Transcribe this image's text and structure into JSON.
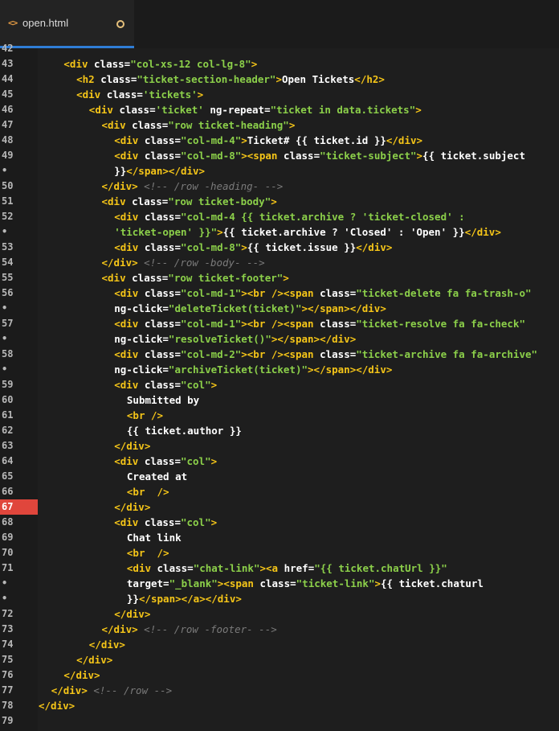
{
  "tab": {
    "icon": "html-code-icon",
    "filename": "open.html",
    "modified_indicator": "unsaved-dot-icon"
  },
  "gutter": {
    "marked_line": "67",
    "colors": {
      "marker": "#e0463c",
      "tag": "#f5c518",
      "string": "#8cd04a",
      "comment": "#7a7a7a"
    }
  },
  "lines": [
    {
      "n": "42",
      "indent": 0,
      "tokens": []
    },
    {
      "n": "43",
      "indent": 4,
      "tokens": [
        [
          "tg",
          "<div "
        ],
        [
          "at",
          "class="
        ],
        [
          "st",
          "\"col-xs-12 col-lg-8\""
        ],
        [
          "tg",
          ">"
        ]
      ]
    },
    {
      "n": "44",
      "indent": 6,
      "tokens": [
        [
          "tg",
          "<h2 "
        ],
        [
          "at",
          "class="
        ],
        [
          "st",
          "\"ticket-section-header\""
        ],
        [
          "tg",
          ">"
        ],
        [
          "tx",
          "Open Tickets"
        ],
        [
          "tg",
          "</h2>"
        ]
      ]
    },
    {
      "n": "45",
      "indent": 6,
      "tokens": [
        [
          "tg",
          "<div "
        ],
        [
          "at",
          "class="
        ],
        [
          "st",
          "'tickets'"
        ],
        [
          "tg",
          ">"
        ]
      ]
    },
    {
      "n": "46",
      "indent": 8,
      "tokens": [
        [
          "tg",
          "<div "
        ],
        [
          "at",
          "class="
        ],
        [
          "st",
          "'ticket'"
        ],
        [
          "at",
          " ng-repeat="
        ],
        [
          "st",
          "\"ticket in data.tickets\""
        ],
        [
          "tg",
          ">"
        ]
      ]
    },
    {
      "n": "47",
      "indent": 10,
      "tokens": [
        [
          "tg",
          "<div "
        ],
        [
          "at",
          "class="
        ],
        [
          "st",
          "\"row ticket-heading\""
        ],
        [
          "tg",
          ">"
        ]
      ]
    },
    {
      "n": "48",
      "indent": 12,
      "tokens": [
        [
          "tg",
          "<div "
        ],
        [
          "at",
          "class="
        ],
        [
          "st",
          "\"col-md-4\""
        ],
        [
          "tg",
          ">"
        ],
        [
          "tx",
          "Ticket# {{ ticket.id }}"
        ],
        [
          "tg",
          "</div>"
        ]
      ]
    },
    {
      "n": "49",
      "indent": 12,
      "tokens": [
        [
          "tg",
          "<div "
        ],
        [
          "at",
          "class="
        ],
        [
          "st",
          "\"col-md-8\""
        ],
        [
          "tg",
          ">"
        ],
        [
          "tg",
          "<span "
        ],
        [
          "at",
          "class="
        ],
        [
          "st",
          "\"ticket-subject\""
        ],
        [
          "tg",
          ">"
        ],
        [
          "tx",
          "{{ ticket.subject"
        ]
      ]
    },
    {
      "n": "•",
      "indent": 12,
      "tokens": [
        [
          "tx",
          "}}"
        ],
        [
          "tg",
          "</span></div>"
        ]
      ]
    },
    {
      "n": "50",
      "indent": 10,
      "tokens": [
        [
          "tg",
          "</div>"
        ],
        [
          "cm",
          " <!-- /row -heading- -->"
        ]
      ]
    },
    {
      "n": "51",
      "indent": 10,
      "tokens": [
        [
          "tg",
          "<div "
        ],
        [
          "at",
          "class="
        ],
        [
          "st",
          "\"row ticket-body\""
        ],
        [
          "tg",
          ">"
        ]
      ]
    },
    {
      "n": "52",
      "indent": 12,
      "tokens": [
        [
          "tg",
          "<div "
        ],
        [
          "at",
          "class="
        ],
        [
          "st",
          "\"col-md-4 {{ ticket.archive ? 'ticket-closed' :"
        ]
      ]
    },
    {
      "n": "•",
      "indent": 12,
      "tokens": [
        [
          "st",
          "'ticket-open' }}\""
        ],
        [
          "tg",
          ">"
        ],
        [
          "tx",
          "{{ ticket.archive ? 'Closed' : 'Open' }}"
        ],
        [
          "tg",
          "</div>"
        ]
      ]
    },
    {
      "n": "53",
      "indent": 12,
      "tokens": [
        [
          "tg",
          "<div "
        ],
        [
          "at",
          "class="
        ],
        [
          "st",
          "\"col-md-8\""
        ],
        [
          "tg",
          ">"
        ],
        [
          "tx",
          "{{ ticket.issue }}"
        ],
        [
          "tg",
          "</div>"
        ]
      ]
    },
    {
      "n": "54",
      "indent": 10,
      "tokens": [
        [
          "tg",
          "</div>"
        ],
        [
          "cm",
          " <!-- /row -body- -->"
        ]
      ]
    },
    {
      "n": "55",
      "indent": 10,
      "tokens": [
        [
          "tg",
          "<div "
        ],
        [
          "at",
          "class="
        ],
        [
          "st",
          "\"row ticket-footer\""
        ],
        [
          "tg",
          ">"
        ]
      ]
    },
    {
      "n": "56",
      "indent": 12,
      "tokens": [
        [
          "tg",
          "<div "
        ],
        [
          "at",
          "class="
        ],
        [
          "st",
          "\"col-md-1\""
        ],
        [
          "tg",
          ">"
        ],
        [
          "tg",
          "<br />"
        ],
        [
          "tg",
          "<span "
        ],
        [
          "at",
          "class="
        ],
        [
          "st",
          "\"ticket-delete fa fa-trash-o\""
        ]
      ]
    },
    {
      "n": "•",
      "indent": 12,
      "tokens": [
        [
          "at",
          "ng-click="
        ],
        [
          "st",
          "\"deleteTicket(ticket)\""
        ],
        [
          "tg",
          "></span></div>"
        ]
      ]
    },
    {
      "n": "57",
      "indent": 12,
      "tokens": [
        [
          "tg",
          "<div "
        ],
        [
          "at",
          "class="
        ],
        [
          "st",
          "\"col-md-1\""
        ],
        [
          "tg",
          ">"
        ],
        [
          "tg",
          "<br />"
        ],
        [
          "tg",
          "<span "
        ],
        [
          "at",
          "class="
        ],
        [
          "st",
          "\"ticket-resolve fa fa-check\""
        ]
      ]
    },
    {
      "n": "•",
      "indent": 12,
      "tokens": [
        [
          "at",
          "ng-click="
        ],
        [
          "st",
          "\"resolveTicket()\""
        ],
        [
          "tg",
          "></span></div>"
        ]
      ]
    },
    {
      "n": "58",
      "indent": 12,
      "tokens": [
        [
          "tg",
          "<div "
        ],
        [
          "at",
          "class="
        ],
        [
          "st",
          "\"col-md-2\""
        ],
        [
          "tg",
          ">"
        ],
        [
          "tg",
          "<br />"
        ],
        [
          "tg",
          "<span "
        ],
        [
          "at",
          "class="
        ],
        [
          "st",
          "\"ticket-archive fa fa-archive\""
        ]
      ]
    },
    {
      "n": "•",
      "indent": 12,
      "tokens": [
        [
          "at",
          "ng-click="
        ],
        [
          "st",
          "\"archiveTicket(ticket)\""
        ],
        [
          "tg",
          "></span></div>"
        ]
      ]
    },
    {
      "n": "59",
      "indent": 12,
      "tokens": [
        [
          "tg",
          "<div "
        ],
        [
          "at",
          "class="
        ],
        [
          "st",
          "\"col\""
        ],
        [
          "tg",
          ">"
        ]
      ]
    },
    {
      "n": "60",
      "indent": 14,
      "tokens": [
        [
          "tx",
          "Submitted by"
        ]
      ]
    },
    {
      "n": "61",
      "indent": 14,
      "tokens": [
        [
          "tg",
          "<br />"
        ]
      ]
    },
    {
      "n": "62",
      "indent": 14,
      "tokens": [
        [
          "tx",
          "{{ ticket.author }}"
        ]
      ]
    },
    {
      "n": "63",
      "indent": 12,
      "tokens": [
        [
          "tg",
          "</div>"
        ]
      ]
    },
    {
      "n": "64",
      "indent": 12,
      "tokens": [
        [
          "tg",
          "<div "
        ],
        [
          "at",
          "class="
        ],
        [
          "st",
          "\"col\""
        ],
        [
          "tg",
          ">"
        ]
      ]
    },
    {
      "n": "65",
      "indent": 14,
      "tokens": [
        [
          "tx",
          "Created at"
        ]
      ]
    },
    {
      "n": "66",
      "indent": 14,
      "tokens": [
        [
          "tg",
          "<br  />"
        ]
      ]
    },
    {
      "n": "67",
      "indent": 12,
      "tokens": [
        [
          "tg",
          "</div>"
        ]
      ]
    },
    {
      "n": "68",
      "indent": 12,
      "tokens": [
        [
          "tg",
          "<div "
        ],
        [
          "at",
          "class="
        ],
        [
          "st",
          "\"col\""
        ],
        [
          "tg",
          ">"
        ]
      ]
    },
    {
      "n": "69",
      "indent": 14,
      "tokens": [
        [
          "tx",
          "Chat link"
        ]
      ]
    },
    {
      "n": "70",
      "indent": 14,
      "tokens": [
        [
          "tg",
          "<br  />"
        ]
      ]
    },
    {
      "n": "71",
      "indent": 14,
      "tokens": [
        [
          "tg",
          "<div "
        ],
        [
          "at",
          "class="
        ],
        [
          "st",
          "\"chat-link\""
        ],
        [
          "tg",
          ">"
        ],
        [
          "tg",
          "<a "
        ],
        [
          "at",
          "href="
        ],
        [
          "st",
          "\"{{ ticket.chatUrl }}\""
        ]
      ]
    },
    {
      "n": "•",
      "indent": 14,
      "tokens": [
        [
          "at",
          "target="
        ],
        [
          "st",
          "\"_blank\""
        ],
        [
          "tg",
          ">"
        ],
        [
          "tg",
          "<span "
        ],
        [
          "at",
          "class="
        ],
        [
          "st",
          "\"ticket-link\""
        ],
        [
          "tg",
          ">"
        ],
        [
          "tx",
          "{{ ticket.chaturl"
        ]
      ]
    },
    {
      "n": "•",
      "indent": 14,
      "tokens": [
        [
          "tx",
          "}}"
        ],
        [
          "tg",
          "</span></a></div>"
        ]
      ]
    },
    {
      "n": "72",
      "indent": 12,
      "tokens": [
        [
          "tg",
          "</div>"
        ]
      ]
    },
    {
      "n": "73",
      "indent": 10,
      "tokens": [
        [
          "tg",
          "</div>"
        ],
        [
          "cm",
          " <!-- /row -footer- -->"
        ]
      ]
    },
    {
      "n": "74",
      "indent": 8,
      "tokens": [
        [
          "tg",
          "</div>"
        ]
      ]
    },
    {
      "n": "75",
      "indent": 6,
      "tokens": [
        [
          "tg",
          "</div>"
        ]
      ]
    },
    {
      "n": "76",
      "indent": 4,
      "tokens": [
        [
          "tg",
          "</div>"
        ]
      ]
    },
    {
      "n": "77",
      "indent": 2,
      "tokens": [
        [
          "tg",
          "</div>"
        ],
        [
          "cm",
          " <!-- /row -->"
        ]
      ]
    },
    {
      "n": "78",
      "indent": 0,
      "tokens": [
        [
          "tg",
          "</div>"
        ]
      ]
    },
    {
      "n": "79",
      "indent": 0,
      "tokens": []
    }
  ]
}
